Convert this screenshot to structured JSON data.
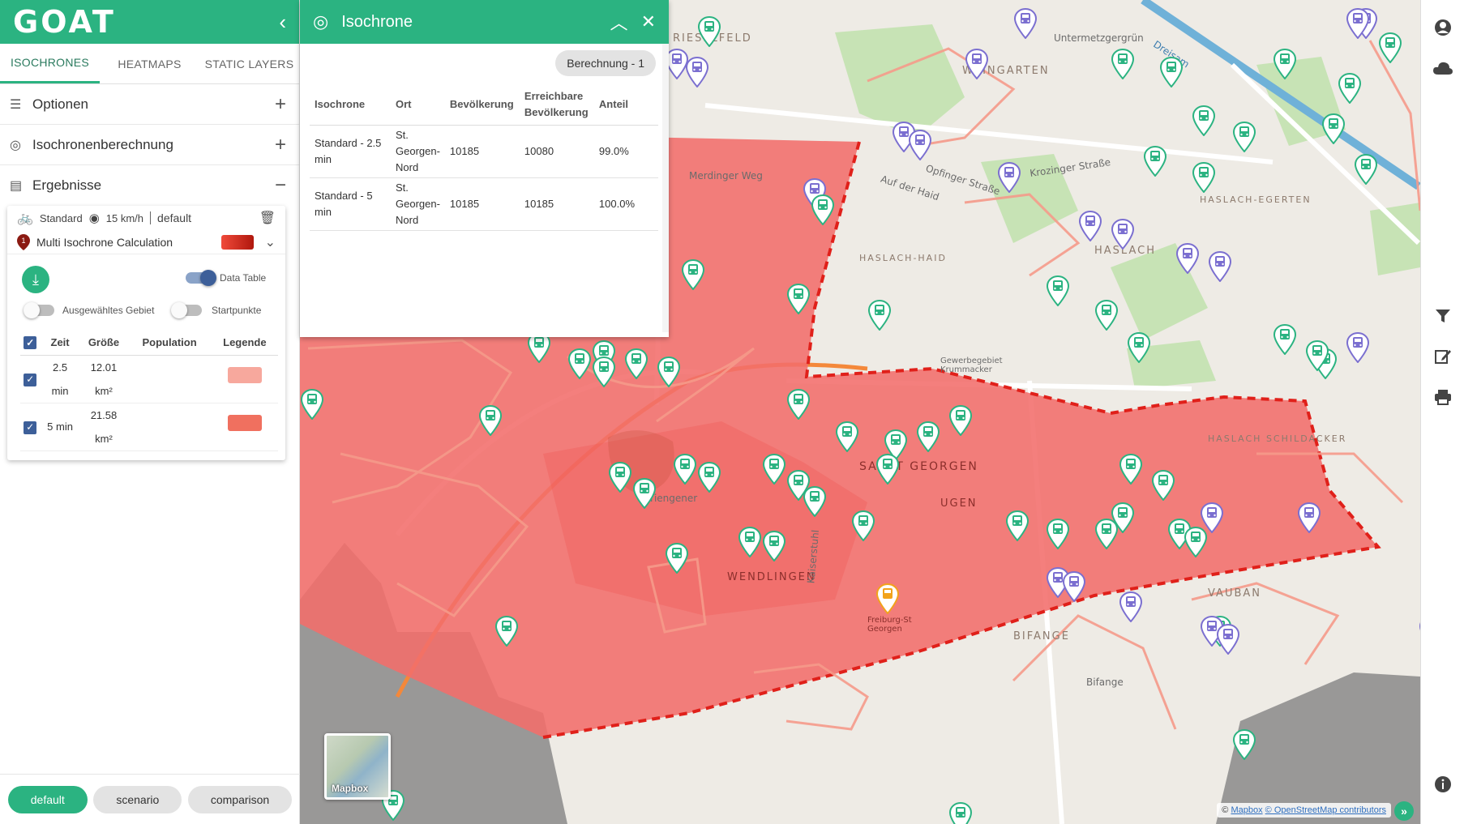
{
  "app": {
    "logo": "GOAT"
  },
  "left_panel": {
    "collapse_icon": "chevron-left-icon",
    "tabs": [
      "ISOCHRONES",
      "HEATMAPS",
      "STATIC LAYERS"
    ],
    "sections": [
      {
        "label": "Optionen",
        "icon": "sliders-icon",
        "action": "+"
      },
      {
        "label": "Isochronenberechnung",
        "icon": "target-icon",
        "action": "+"
      },
      {
        "label": "Ergebnisse",
        "icon": "list-icon",
        "action": "−"
      }
    ],
    "result": {
      "mode": "Standard",
      "speed": "15 km/h",
      "profile": "default",
      "calc_marker": "1",
      "calc_title": "Multi Isochrone Calculation",
      "data_table_label": "Data Table",
      "selected_area_label": "Ausgewähltes Gebiet",
      "start_points_label": "Startpunkte",
      "table": {
        "headers": [
          "Zeit",
          "Größe",
          "Population",
          "Legende"
        ],
        "rows": [
          {
            "zeit_value": "2.5",
            "zeit_unit": "min",
            "groesse_value": "12.01",
            "groesse_unit": "km²",
            "population": "",
            "legend_color": "#f7a89d"
          },
          {
            "zeit_value": "5 min",
            "zeit_unit": "",
            "groesse_value": "21.58",
            "groesse_unit": "km²",
            "population": "",
            "legend_color": "#f0705f"
          }
        ]
      }
    },
    "bottom_buttons": [
      "default",
      "scenario",
      "comparison"
    ]
  },
  "iso_panel": {
    "title": "Isochrone",
    "calc_chip": "Berechnung - 1",
    "headers": [
      "Isochrone",
      "Ort",
      "Bevölkerung",
      "Erreichbare Bevölkerung",
      "Anteil"
    ],
    "rows": [
      {
        "isochrone": "Standard - 2.5 min",
        "ort": "St. Georgen-Nord",
        "bevoelkerung": "10185",
        "erreichbar": "10080",
        "anteil": "99.0%"
      },
      {
        "isochrone": "Standard - 5 min",
        "ort": "St. Georgen-Nord",
        "bevoelkerung": "10185",
        "erreichbar": "10185",
        "anteil": "100.0%"
      }
    ]
  },
  "map": {
    "labels": {
      "weingarten": "WEINGARTEN",
      "rieselfeld": "RIESELFELD",
      "haslach": "HASLACH",
      "haslach_haid": "HASLACH-HAID",
      "haslach_egerten": "HASLACH-EGERTEN",
      "sankt_georgen": "SANKT GEORGEN",
      "wendlingen": "WENDLINGEN",
      "bifange": "BIFANGE",
      "haslach_schildacker": "HASLACH SCHILDACKER",
      "vauban": "VAUBAN",
      "ugen": "UGEN"
    },
    "streets": {
      "merdinger_weg": "Merdinger Weg",
      "opfinger_strasse": "Opfinger Straße",
      "krozinger_strasse": "Krozinger Straße",
      "auf_der_haid": "Auf der Haid",
      "untermetzgergrun": "Untermetzgergrün",
      "dreisam": "Dreisam",
      "tiengener": "Tiengener",
      "kaiserstuhl": "Kaiserstuhl",
      "bifange_street": "Bifange",
      "freiburg_st_georgen": "Freiburg-St Georgen",
      "gewerbegebiet": "Gewerbegebiet Krummacker"
    },
    "basemap_label": "Mapbox",
    "attribution_prefix": "©",
    "attribution_mapbox": "Mapbox",
    "attribution_osm": "© OpenStreetMap contributors",
    "attribution_toggle": "»",
    "colors": {
      "iso_fill": "#f26d6b",
      "iso_border": "#e0201a",
      "green_pin": "#2bb381",
      "purple_pin": "#7b6fd0",
      "gold_pin": "#f2a31b"
    }
  },
  "right_rail": {
    "icons": [
      "account-icon",
      "cloud-icon",
      "filter-icon",
      "edit-icon",
      "print-icon",
      "info-icon"
    ]
  }
}
